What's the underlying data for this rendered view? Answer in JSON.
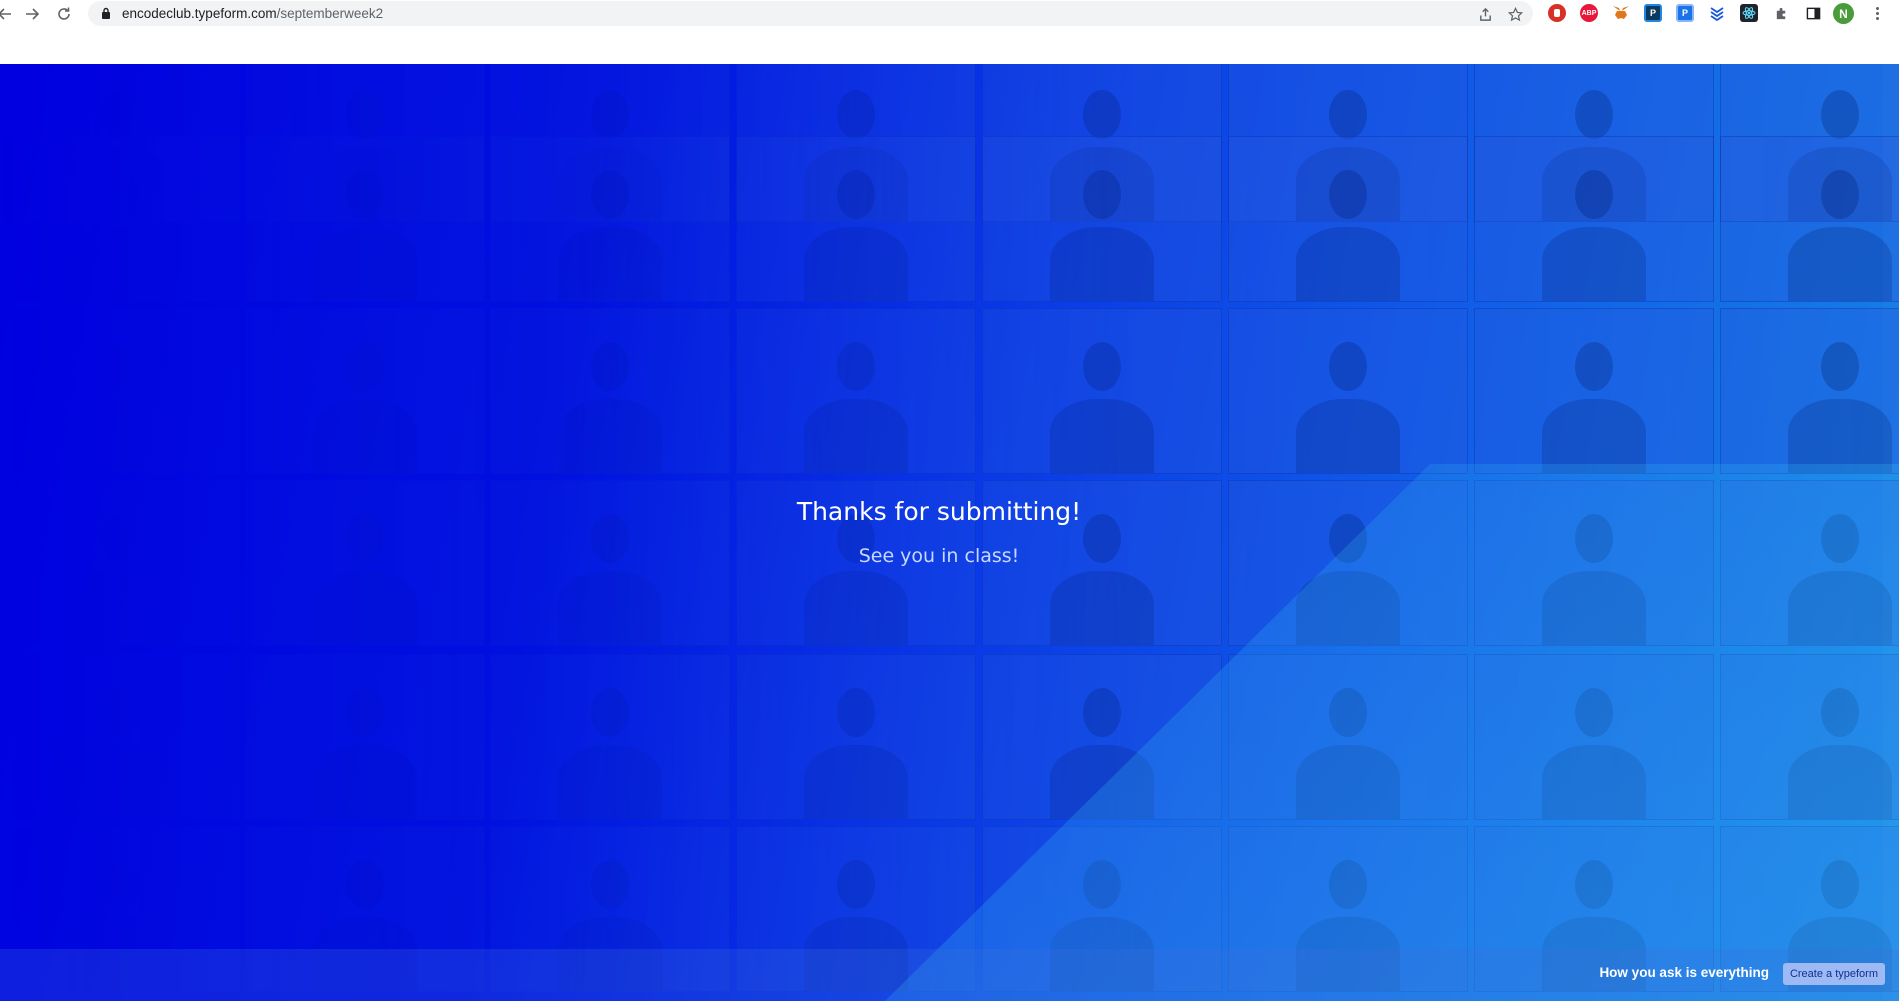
{
  "browser": {
    "url_host": "encodeclub.typeform.com",
    "url_path": "/septemberweek2",
    "profile_initial": "N",
    "extensions": [
      {
        "icon": "adblock-stop-icon",
        "label": "",
        "color": "#d93025"
      },
      {
        "icon": "abp-icon",
        "label": "ABP",
        "color": "#e8173b"
      },
      {
        "icon": "metamask-fox-icon",
        "label": "",
        "color": "#e2761b"
      },
      {
        "icon": "p-extension-icon",
        "label": "P",
        "color": "#0d3a5c"
      },
      {
        "icon": "p-blue-extension-icon",
        "label": "P",
        "color": "#1a73e8"
      },
      {
        "icon": "stack-extension-icon",
        "label": "",
        "color": "#1a56db"
      },
      {
        "icon": "react-devtools-icon",
        "label": "",
        "color": "#20232a"
      },
      {
        "icon": "puzzle-piece-icon",
        "label": "",
        "color": "#5f6368"
      },
      {
        "icon": "side-panel-icon",
        "label": "",
        "color": "#202124"
      }
    ]
  },
  "page": {
    "title": "Thanks for submitting!",
    "subtitle": "See you in class!",
    "footer_tagline": "How you ask is everything",
    "footer_button": "Create a typeform"
  },
  "colors": {
    "background_start": "#0000e0",
    "background_end": "#1684e6",
    "button_bg": "#9dbaf5",
    "button_text": "#103090"
  }
}
